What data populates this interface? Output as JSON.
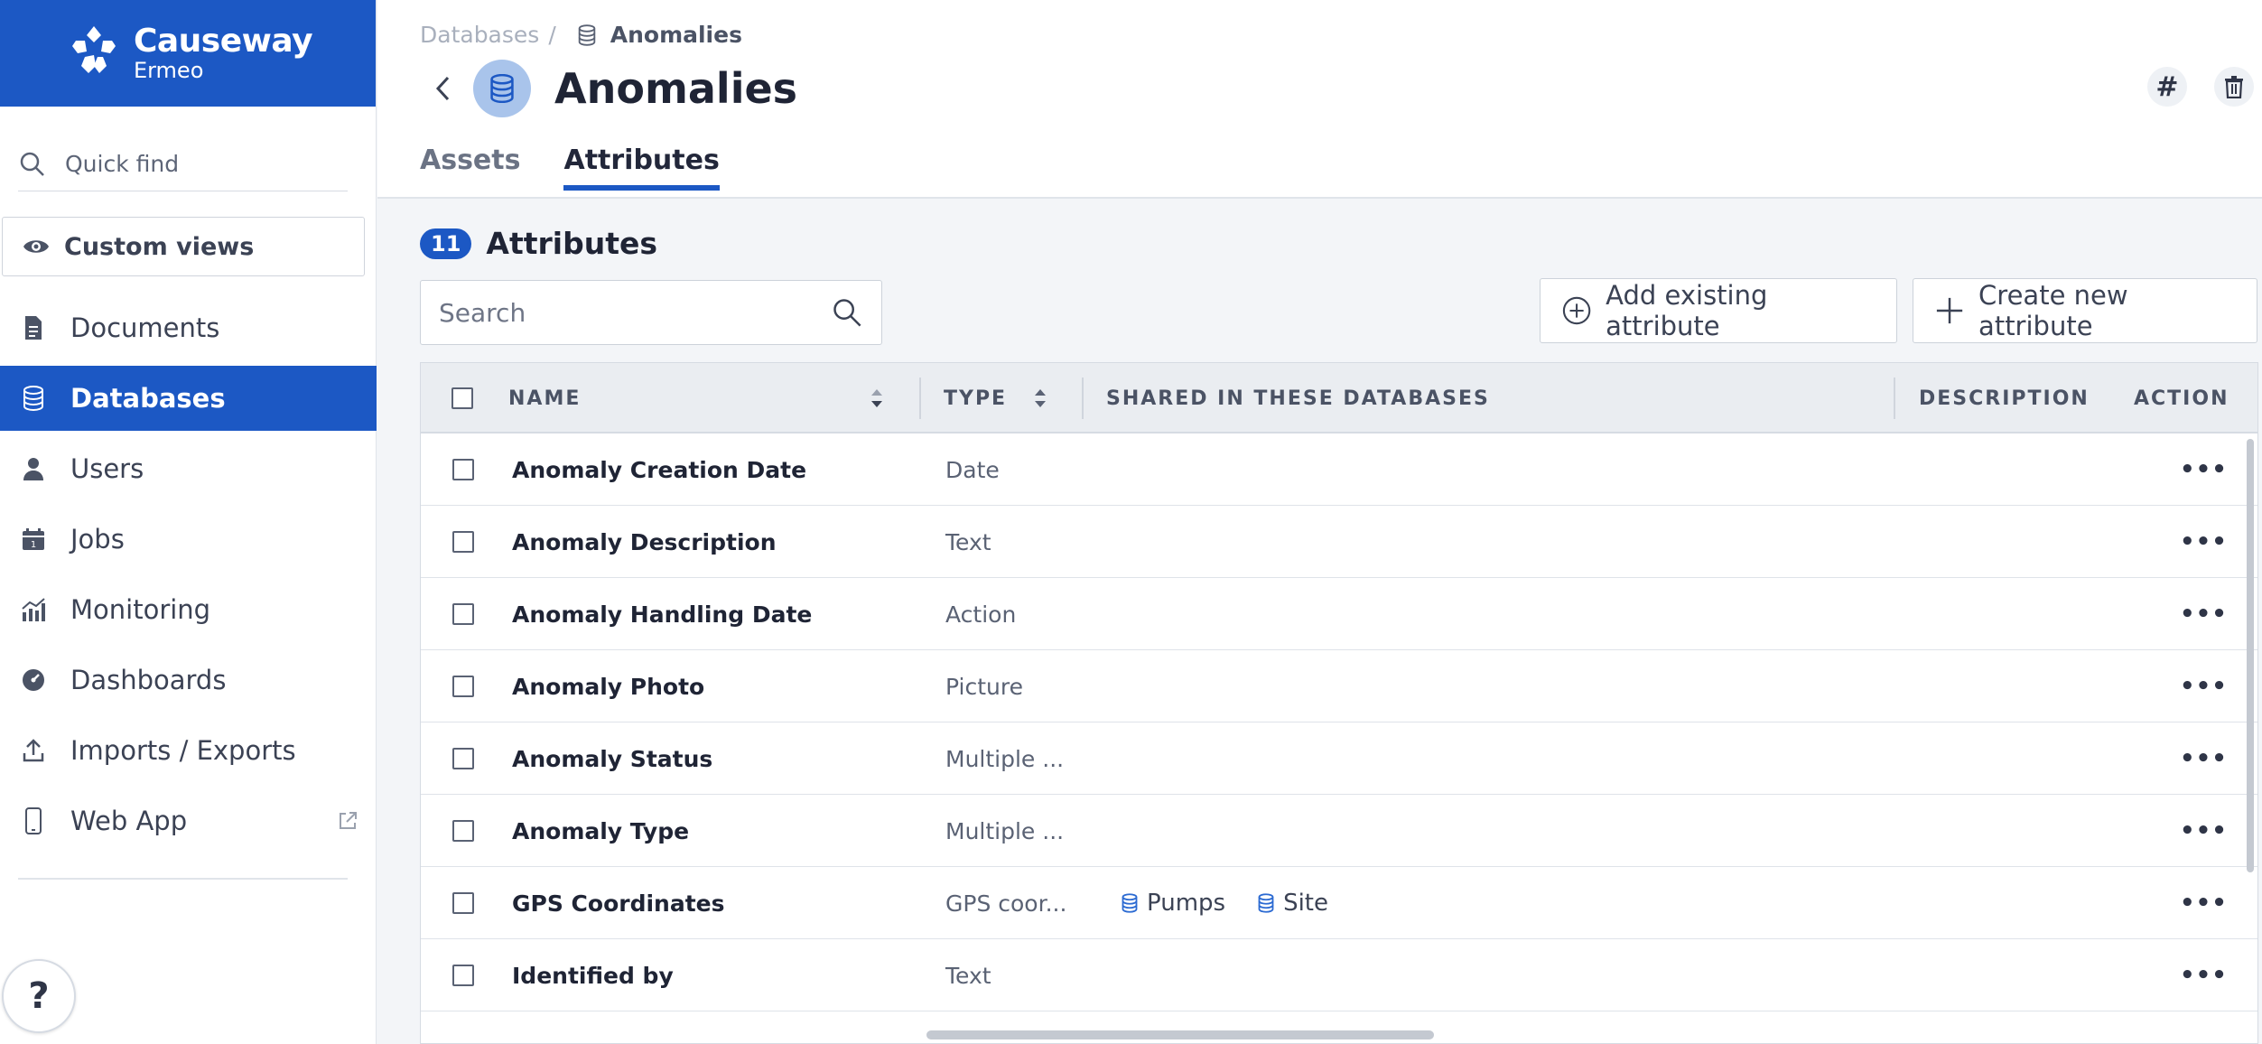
{
  "brand": {
    "name": "Causeway",
    "subname": "Ermeo"
  },
  "sidebar": {
    "quickfind_placeholder": "Quick find",
    "custom_views": "Custom views",
    "items": [
      {
        "label": "Documents",
        "icon": "document-icon",
        "active": false
      },
      {
        "label": "Databases",
        "icon": "database-icon",
        "active": true
      },
      {
        "label": "Users",
        "icon": "user-icon",
        "active": false
      },
      {
        "label": "Jobs",
        "icon": "calendar-icon",
        "active": false
      },
      {
        "label": "Monitoring",
        "icon": "chart-icon",
        "active": false
      },
      {
        "label": "Dashboards",
        "icon": "gauge-icon",
        "active": false
      },
      {
        "label": "Imports / Exports",
        "icon": "upload-icon",
        "active": false
      },
      {
        "label": "Web App",
        "icon": "phone-icon",
        "active": false
      }
    ],
    "help": "?"
  },
  "breadcrumb": {
    "parent": "Databases",
    "separator": "/",
    "current": "Anomalies"
  },
  "header": {
    "title": "Anomalies",
    "hash_button": "#",
    "tabs": [
      {
        "label": "Assets",
        "active": false
      },
      {
        "label": "Attributes",
        "active": true
      }
    ]
  },
  "main": {
    "count": "11",
    "section_title": "Attributes",
    "search_placeholder": "Search",
    "add_existing_label": "Add existing attribute",
    "create_new_label": "Create new attribute"
  },
  "table": {
    "columns": {
      "name": "NAME",
      "type": "TYPE",
      "shared": "SHARED IN THESE DATABASES",
      "description": "DESCRIPTION",
      "action": "ACTION"
    },
    "rows": [
      {
        "name": "Anomaly Creation Date",
        "type": "Date",
        "shared": []
      },
      {
        "name": "Anomaly Description",
        "type": "Text",
        "shared": []
      },
      {
        "name": "Anomaly Handling Date",
        "type": "Action",
        "shared": []
      },
      {
        "name": "Anomaly Photo",
        "type": "Picture",
        "shared": []
      },
      {
        "name": "Anomaly Status",
        "type": "Multiple ...",
        "shared": []
      },
      {
        "name": "Anomaly Type",
        "type": "Multiple ...",
        "shared": []
      },
      {
        "name": "GPS Coordinates",
        "type": "GPS coor...",
        "shared": [
          "Pumps",
          "Site"
        ]
      },
      {
        "name": "Identified by",
        "type": "Text",
        "shared": []
      }
    ],
    "action_label": "•••"
  },
  "colors": {
    "brand": "#1c58c4",
    "active_nav": "#1c58c4",
    "db_badge": "#a9c4eb"
  }
}
